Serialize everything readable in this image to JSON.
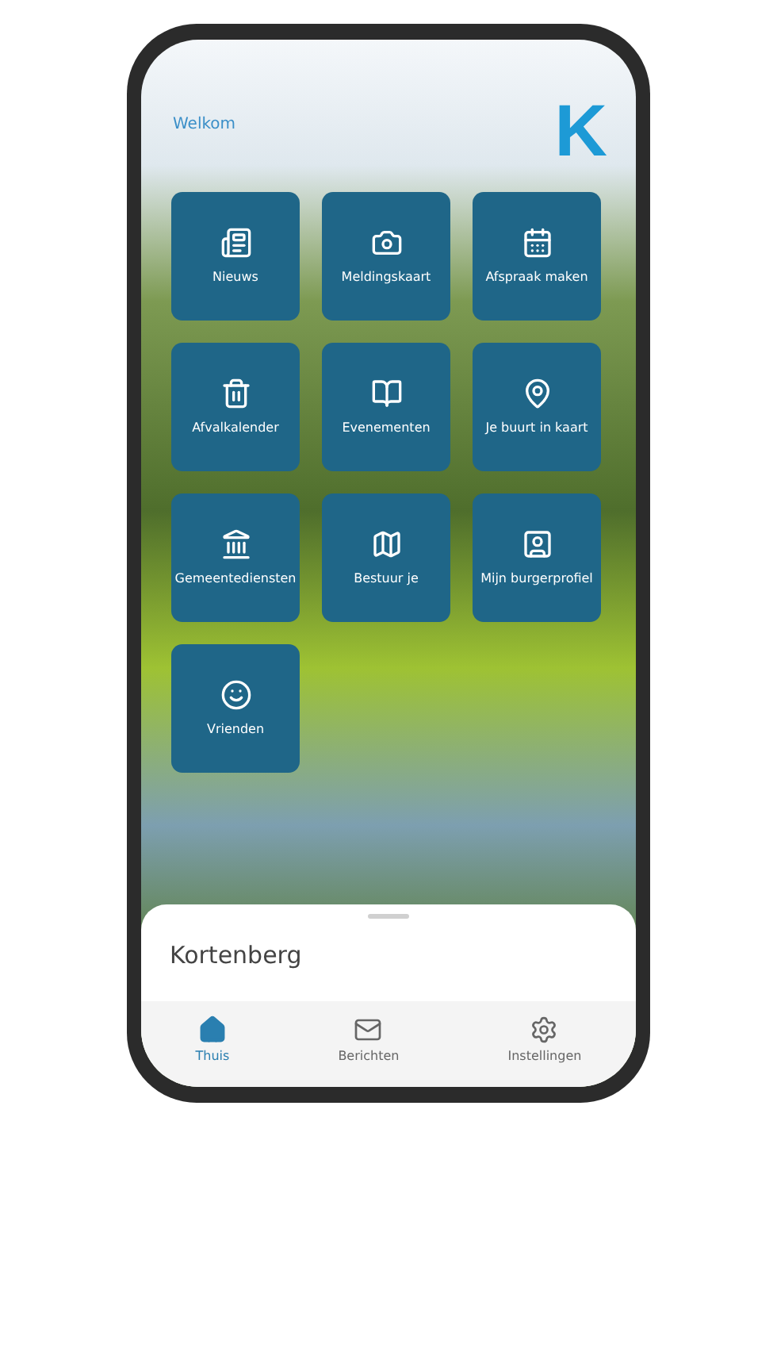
{
  "header": {
    "greeting": "Welkom",
    "logo": "K"
  },
  "tiles": [
    {
      "label": "Nieuws"
    },
    {
      "label": "Meldingskaart"
    },
    {
      "label": "Afspraak maken"
    },
    {
      "label": "Afvalkalender"
    },
    {
      "label": "Evenementen"
    },
    {
      "label": "Je buurt in kaart"
    },
    {
      "label": "Gemeentediensten"
    },
    {
      "label": "Bestuur je"
    },
    {
      "label": "Mijn burgerprofiel"
    },
    {
      "label": "Vrienden"
    }
  ],
  "sheet": {
    "title": "Kortenberg"
  },
  "nav": [
    {
      "label": "Thuis",
      "selected": true
    },
    {
      "label": "Berichten",
      "selected": false
    },
    {
      "label": "Instellingen",
      "selected": false
    }
  ]
}
